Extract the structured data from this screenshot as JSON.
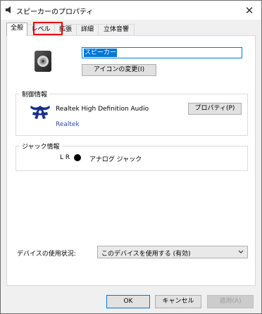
{
  "window": {
    "title": "スピーカーのプロパティ",
    "close_glyph": "✕"
  },
  "tabs": [
    {
      "label": "全般",
      "selected": true
    },
    {
      "label": "レベル",
      "selected": false,
      "highlighted": true
    },
    {
      "label": "拡張",
      "selected": false
    },
    {
      "label": "詳細",
      "selected": false
    },
    {
      "label": "立体音響",
      "selected": false
    }
  ],
  "general": {
    "device_name": "スピーカー",
    "change_icon_label": "アイコンの変更(I)",
    "controller_group_label": "制御情報",
    "driver_name": "Realtek High Definition Audio",
    "properties_label": "プロパティ(P)",
    "manufacturer_link": "Realtek",
    "jack_group_label": "ジャック情報",
    "jack_channels": "L R",
    "jack_description": "アナログ ジャック",
    "usage_label": "デバイスの使用状況:",
    "usage_value": "このデバイスを使用する (有効)"
  },
  "footer": {
    "ok_label": "OK",
    "cancel_label": "キャンセル",
    "apply_label": "適用(A)"
  },
  "colors": {
    "accent": "#0078d7",
    "highlight": "#e60012",
    "link": "#2a4aa0"
  },
  "icons": [
    "speaker-icon",
    "close-icon",
    "realtek-logo-icon",
    "chevron-down-icon"
  ]
}
